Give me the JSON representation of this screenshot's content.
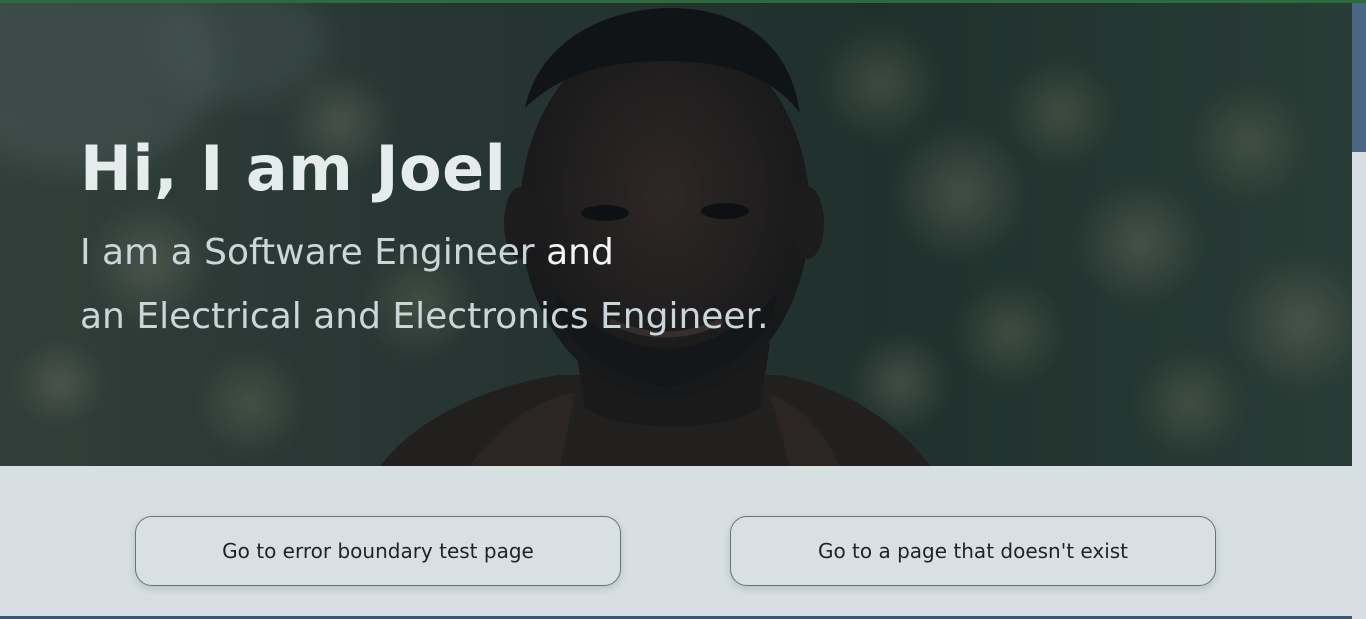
{
  "hero": {
    "title": "Hi, I am Joel",
    "line1_text": "I am a Software Engineer ",
    "line1_emphasis": "and",
    "line2_text": "an Electrical and Electronics Engineer.",
    "background": "portrait-photo"
  },
  "buttons": {
    "error_boundary_label": "Go to error boundary test page",
    "not_found_label": "Go to a page that doesn't exist"
  },
  "colors": {
    "hero_tint": "#0c1e26",
    "page_bg": "#d7dfe2",
    "scrollbar_thumb": "#4a6685",
    "top_accent": "#2f6a3a"
  }
}
